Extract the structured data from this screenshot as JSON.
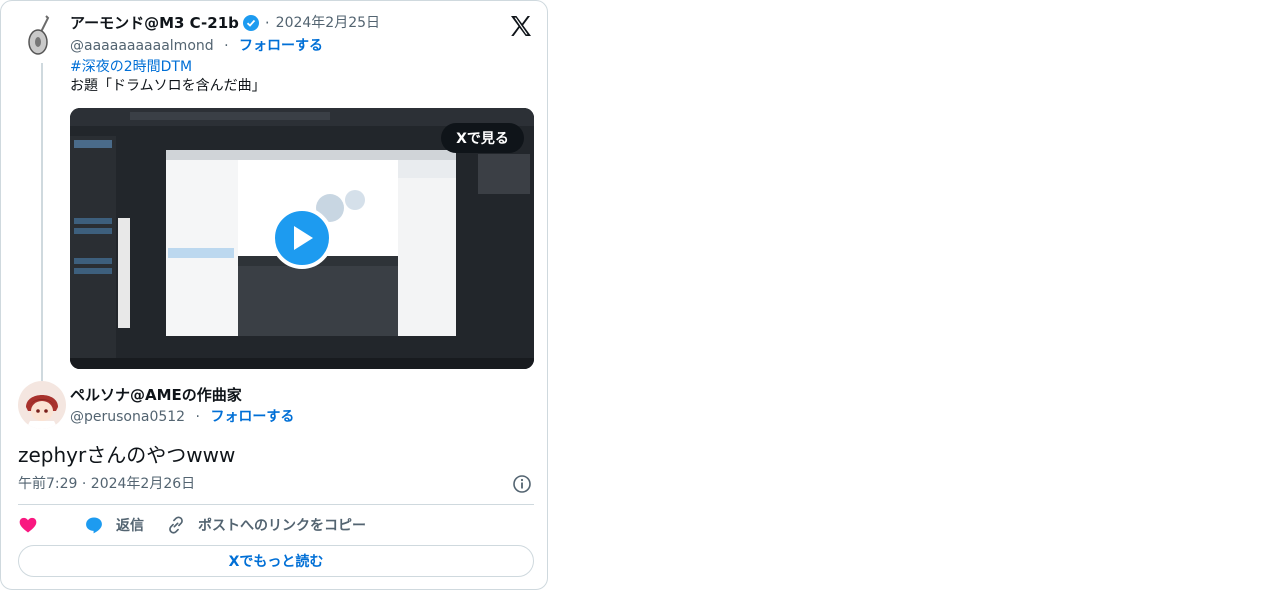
{
  "parent_tweet": {
    "display_name": "アーモンド@M3 C-21b",
    "date": "2024年2月25日",
    "handle": "@aaaaaaaaaalmond",
    "follow_label": "フォローする",
    "hashtag": "#深夜の2時間DTM",
    "text": "お題「ドラムソロを含んだ曲」",
    "media_overlay_label": "Xで見る"
  },
  "reply_tweet": {
    "display_name": "ペルソナ@AMEの作曲家",
    "handle": "@perusona0512",
    "follow_label": "フォローする",
    "text": "zephyrさんのやつwww",
    "timestamp": "午前7:29 · 2024年2月26日"
  },
  "actions": {
    "reply_label": "返信",
    "copy_link_label": "ポストへのリンクをコピー"
  },
  "read_more_label": "Xでもっと読む",
  "colors": {
    "link": "#006fd6",
    "verified": "#1d9bf0",
    "like": "#f91880",
    "play": "#1d9bf0"
  }
}
